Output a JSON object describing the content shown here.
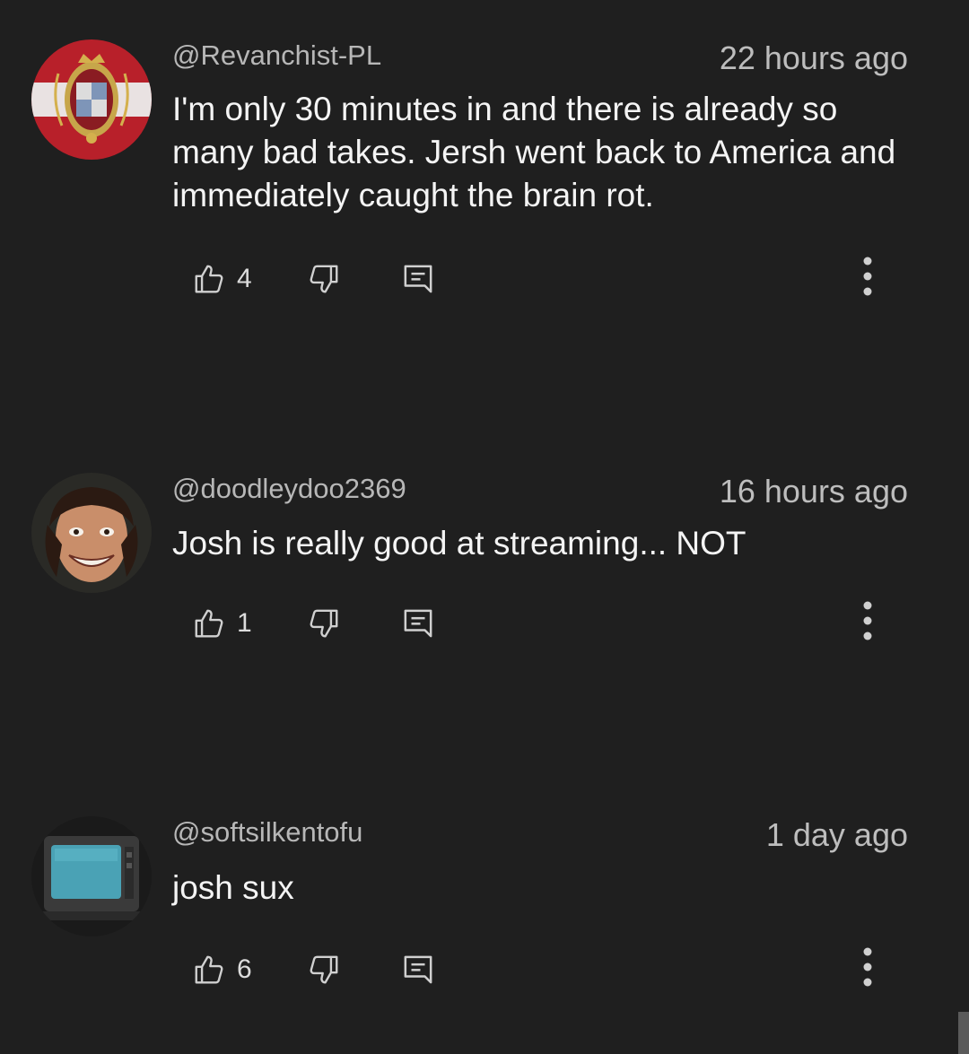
{
  "colors": {
    "background": "#1f1f1f",
    "author": "#b7b7b7",
    "text": "#f4f4f4",
    "timestamp": "#bdbdbd",
    "icon": "#d0d0d0"
  },
  "comments": [
    {
      "author": "@Revanchist-PL",
      "time": "22 hours ago",
      "text": "I'm only 30 minutes in and there is already so many bad takes. Jersh went back to America and immediately caught the brain rot.",
      "likes": "4",
      "avatar": "polish-crest-avatar"
    },
    {
      "author": "@doodleydoo2369",
      "time": "16 hours ago",
      "text": "Josh is really good at streaming... NOT",
      "likes": "1",
      "avatar": "grinning-face-avatar"
    },
    {
      "author": "@softsilkentofu",
      "time": "1 day ago",
      "text": "josh sux",
      "likes": "6",
      "avatar": "crt-monitor-avatar"
    }
  ],
  "icons": {
    "like": "thumbs-up-icon",
    "dislike": "thumbs-down-icon",
    "reply": "reply-comment-icon",
    "more": "more-vert-icon"
  }
}
